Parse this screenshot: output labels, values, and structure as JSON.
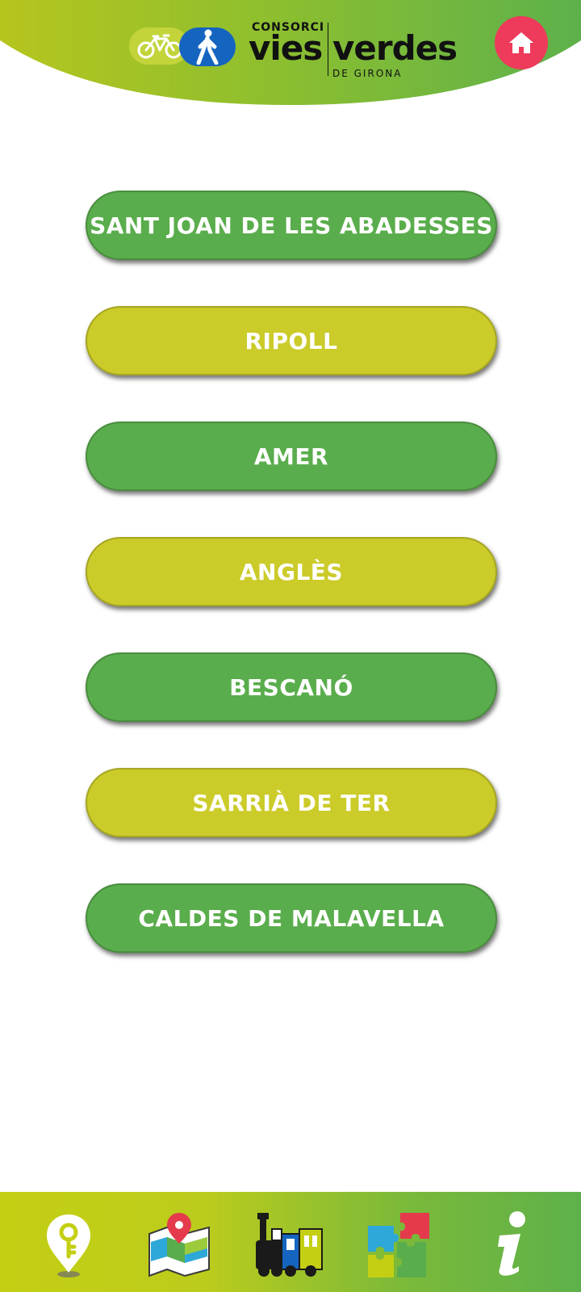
{
  "header": {
    "logo": {
      "consorci": "CONSORCI",
      "vies": "vies",
      "verdes": "verdes",
      "de_girona": "DE GIRONA"
    },
    "home_icon": "home-icon",
    "accent": "#ee3a5b"
  },
  "towns": [
    {
      "label": "SANT JOAN DE LES ABADESSES",
      "color": "#5aad4c"
    },
    {
      "label": "RIPOLL",
      "color": "#cbcb2a"
    },
    {
      "label": "AMER",
      "color": "#5aad4c"
    },
    {
      "label": "ANGLÈS",
      "color": "#cbcb2a"
    },
    {
      "label": "BESCANÓ",
      "color": "#5aad4c"
    },
    {
      "label": "SARRIÀ DE TER",
      "color": "#cbcb2a"
    },
    {
      "label": "CALDES DE MALAVELLA",
      "color": "#5aad4c"
    }
  ],
  "bottom_nav": [
    {
      "icon": "location-key-icon"
    },
    {
      "icon": "map-icon"
    },
    {
      "icon": "train-icon"
    },
    {
      "icon": "puzzle-icon"
    },
    {
      "icon": "info-icon"
    }
  ]
}
